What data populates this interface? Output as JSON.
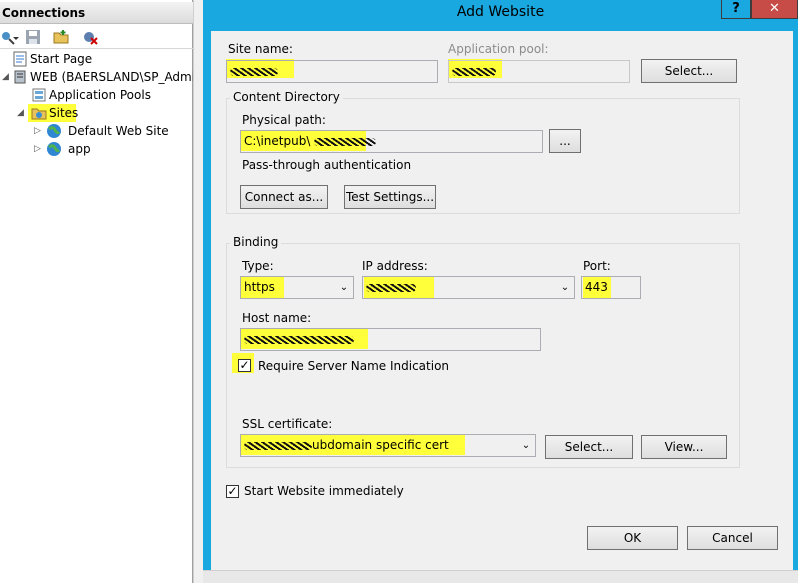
{
  "connections": {
    "header": "Connections",
    "tree": [
      {
        "label": "Start Page"
      },
      {
        "label": "WEB (BAERSLAND\\SP_Admin)"
      },
      {
        "label": "Application Pools"
      },
      {
        "label": "Sites"
      },
      {
        "label": "Default Web Site"
      },
      {
        "label": "app"
      }
    ]
  },
  "dialog": {
    "title": "Add Website",
    "help": "?",
    "close": "✕",
    "site_name": {
      "label": "Site name:",
      "value": ""
    },
    "app_pool": {
      "label": "Application pool:",
      "value": ""
    },
    "select_pool_button": "Select...",
    "content_directory": {
      "title": "Content Directory",
      "physical_path_label": "Physical path:",
      "physical_path_value": "C:\\inetpub\\",
      "browse_button": "...",
      "pass_through": "Pass-through authentication",
      "connect_as_button": "Connect as...",
      "test_settings_button": "Test Settings..."
    },
    "binding": {
      "title": "Binding",
      "type_label": "Type:",
      "type_value": "https",
      "ip_label": "IP address:",
      "ip_value": "",
      "port_label": "Port:",
      "port_value": "443",
      "host_label": "Host name:",
      "host_value": "",
      "sni_label": "Require Server Name Indication",
      "sni_checked": true,
      "ssl_label": "SSL certificate:",
      "ssl_value": "ubdomain specific cert",
      "ssl_select_button": "Select...",
      "ssl_view_button": "View..."
    },
    "start_immediately": {
      "label": "Start Website immediately",
      "checked": true
    },
    "ok_button": "OK",
    "cancel_button": "Cancel"
  },
  "colors": {
    "titlebar": "#1aa8e0",
    "highlight": "#ffff3a",
    "close_button": "#c74b47"
  }
}
